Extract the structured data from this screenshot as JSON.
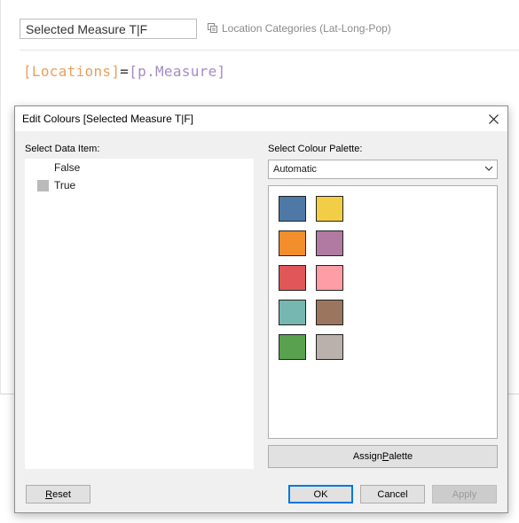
{
  "editor": {
    "calc_name": "Selected Measure T|F",
    "datasource": "Location Categories (Lat-Long-Pop)",
    "formula": {
      "field": "[Locations]",
      "op": "=",
      "param": "[p.Measure]"
    }
  },
  "dialog": {
    "title": "Edit Colours [Selected Measure T|F]",
    "select_data_item_label": "Select Data Item:",
    "data_items": [
      {
        "label": "False",
        "color": "#ffffff"
      },
      {
        "label": "True",
        "color": "#bababa"
      }
    ],
    "select_palette_label": "Select Colour Palette:",
    "palette_value": "Automatic",
    "palette_colors": [
      "#4e79a7",
      "#f1ce46",
      "#f28e2b",
      "#b07aa1",
      "#e15759",
      "#ff9da7",
      "#76b7b2",
      "#9c755f",
      "#59a14f",
      "#bab0ac"
    ],
    "buttons": {
      "assign": "Assign Palette",
      "reset": "Reset",
      "ok": "OK",
      "cancel": "Cancel",
      "apply": "Apply"
    }
  }
}
